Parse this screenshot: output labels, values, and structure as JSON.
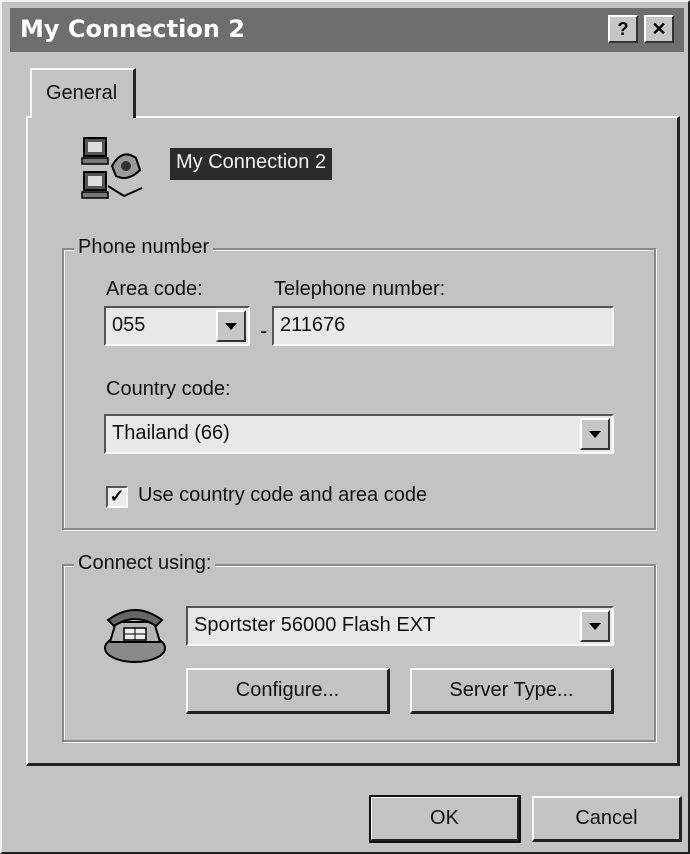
{
  "window": {
    "title": "My Connection 2",
    "help_glyph": "?",
    "close_glyph": "✕"
  },
  "tabs": [
    {
      "label": "General"
    }
  ],
  "connection": {
    "name": "My Connection 2"
  },
  "phone_group": {
    "label": "Phone number",
    "area_code_label": "Area code:",
    "area_code_value": "055",
    "telephone_label": "Telephone number:",
    "telephone_value": "211676",
    "country_label": "Country code:",
    "country_value": "Thailand (66)",
    "use_codes_label": "Use country code and area code",
    "use_codes_checked": true
  },
  "connect_group": {
    "label": "Connect using:",
    "device_value": "Sportster 56000 Flash EXT",
    "configure_label": "Configure...",
    "server_type_label": "Server Type..."
  },
  "dialog_buttons": {
    "ok_label": "OK",
    "cancel_label": "Cancel"
  },
  "icons": [
    "computer-network-icon",
    "modem-phone-icon",
    "dropdown-arrow-icon",
    "help-icon",
    "close-icon",
    "checkmark-icon"
  ]
}
